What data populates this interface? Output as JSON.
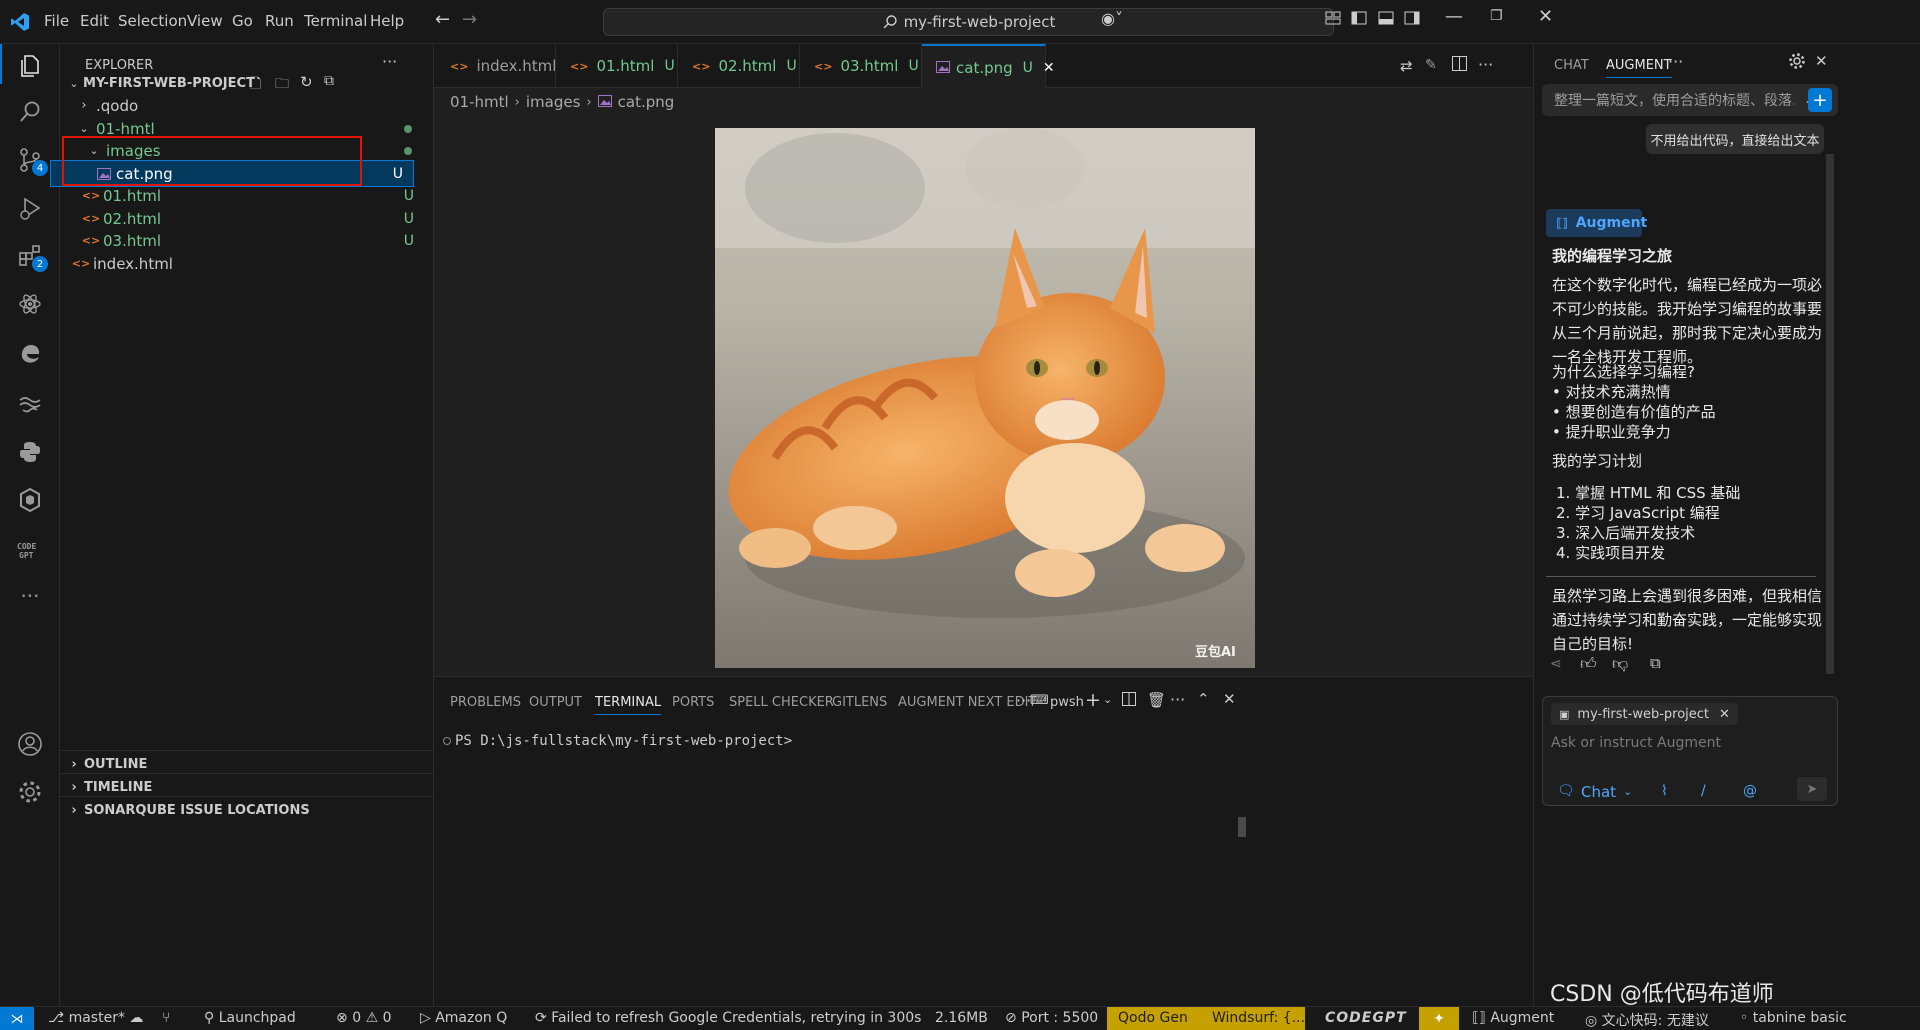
{
  "menu": [
    "File",
    "Edit",
    "Selection",
    "View",
    "Go",
    "Run",
    "Terminal",
    "Help"
  ],
  "command_center": "my-first-web-project",
  "explorer": {
    "title": "EXPLORER",
    "project": "MY-FIRST-WEB-PROJECT",
    "items": [
      {
        "label": ".qodo",
        "git": ""
      },
      {
        "label": "01-hmtl",
        "git": ""
      },
      {
        "label": "images",
        "git": ""
      },
      {
        "label": "cat.png",
        "git": "U"
      },
      {
        "label": "01.html",
        "git": "U"
      },
      {
        "label": "02.html",
        "git": "U"
      },
      {
        "label": "03.html",
        "git": "U"
      },
      {
        "label": "index.html",
        "git": ""
      }
    ],
    "sections": [
      "OUTLINE",
      "TIMELINE",
      "SONARQUBE ISSUE LOCATIONS"
    ]
  },
  "activity_badges": {
    "scm": "4",
    "extensions": "2"
  },
  "tabs": [
    {
      "label": "index.html",
      "status": ""
    },
    {
      "label": "01.html",
      "status": "U"
    },
    {
      "label": "02.html",
      "status": "U"
    },
    {
      "label": "03.html",
      "status": "U"
    },
    {
      "label": "cat.png",
      "status": "U"
    }
  ],
  "breadcrumb": [
    "01-hmtl",
    "images",
    "cat.png"
  ],
  "image_watermark": "豆包AI",
  "panel": {
    "tabs": [
      "PROBLEMS",
      "OUTPUT",
      "TERMINAL",
      "PORTS",
      "SPELL CHECKER",
      "GITLENS",
      "AUGMENT NEXT EDIT"
    ],
    "shell": "pwsh",
    "prompt": "PS D:\\js-fullstack\\my-first-web-project>"
  },
  "aux": {
    "tabs": [
      "CHAT",
      "AUGMENT"
    ],
    "prompt_text": "整理一篇短文，使用合适的标题、段落...",
    "user_message": "不用给出代码，直接给出文本",
    "agent_label": "Augment",
    "response": {
      "title": "我的编程学习之旅",
      "para1": "在这个数字化时代，编程已经成为一项必不可少的技能。我开始学习编程的故事要从三个月前说起，那时我下定决心要成为一名全栈开发工程师。",
      "why_title": "为什么选择学习编程?",
      "why_items": [
        "• 对技术充满热情",
        "• 想要创造有价值的产品",
        "• 提升职业竞争力"
      ],
      "plan_title": "我的学习计划",
      "plan_items": [
        "1. 掌握 HTML 和 CSS 基础",
        "2. 学习 JavaScript 编程",
        "3. 深入后端开发技术",
        "4. 实践项目开发"
      ],
      "closing": "虽然学习路上会遇到很多困难，但我相信通过持续学习和勤奋实践，一定能够实现自己的目标!"
    },
    "context_chip": "my-first-web-project",
    "input_placeholder": "Ask or instruct Augment",
    "mode": "Chat"
  },
  "status": {
    "branch": "master*",
    "launchpad": "Launchpad",
    "errors": "0",
    "warnings": "0",
    "amazonq": "Amazon Q",
    "google": "Failed to refresh Google Credentials, retrying in 300s",
    "memory": "2.16MB",
    "port": "Port : 5500",
    "qodo": "Qodo Gen",
    "windsurf": "Windsurf: {...}",
    "codegpt": "CODEGPT",
    "augment": "Augment",
    "wenxin": "文心快码: 无建议",
    "tabnine": "tabnine basic"
  },
  "overlay_watermark": "CSDN @低代码布道师",
  "colors": {
    "accent": "#0078d4",
    "git_untracked": "#73c991",
    "html_icon": "#e37933",
    "highlight_box": "#e51400",
    "status_yellow": "#c5a100"
  }
}
